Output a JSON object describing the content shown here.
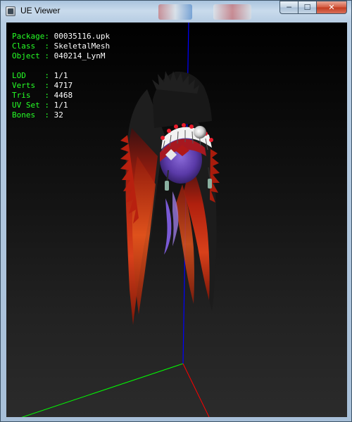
{
  "window": {
    "title": "UE Viewer"
  },
  "caption_buttons": {
    "minimize": "─",
    "maximize": "☐",
    "close": "✕"
  },
  "info": {
    "group1": [
      {
        "label": "Package",
        "value": "00035116.upk"
      },
      {
        "label": "Class  ",
        "value": "SkeletalMesh"
      },
      {
        "label": "Object ",
        "value": "040214_LynM"
      }
    ],
    "group2": [
      {
        "label": "LOD    ",
        "value": "1/1"
      },
      {
        "label": "Verts  ",
        "value": "4717"
      },
      {
        "label": "Tris   ",
        "value": "4468"
      },
      {
        "label": "UV Set ",
        "value": "1/1"
      },
      {
        "label": "Bones  ",
        "value": "32"
      }
    ]
  },
  "colors": {
    "label": "#26ff26",
    "value": "#ffffff",
    "axis_x": "#ff0000",
    "axis_y": "#00ff00",
    "axis_z": "#0000ff"
  }
}
